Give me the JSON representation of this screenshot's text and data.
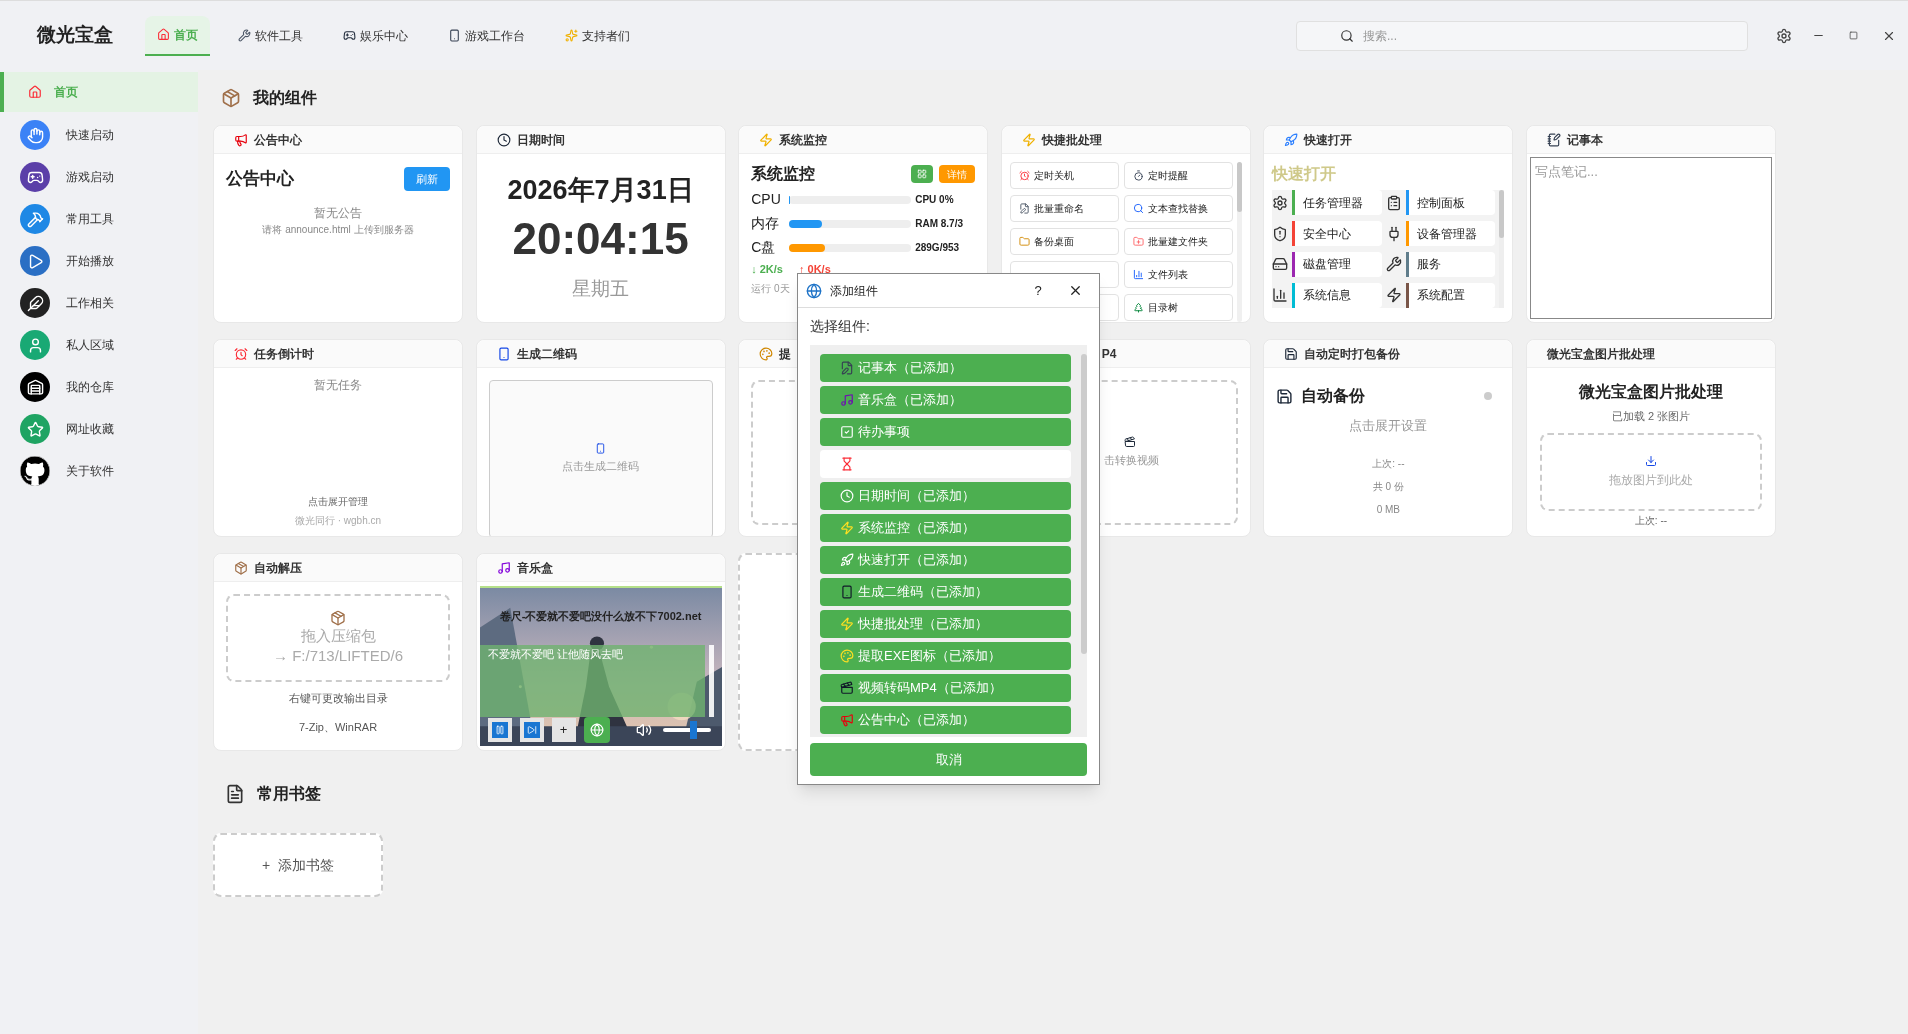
{
  "app": {
    "title": "微光宝盒"
  },
  "nav_tabs": [
    {
      "label": "首页",
      "selected": true
    },
    {
      "label": "软件工具",
      "selected": false
    },
    {
      "label": "娱乐中心",
      "selected": false
    },
    {
      "label": "游戏工作台",
      "selected": false
    },
    {
      "label": "支持者们",
      "selected": false
    }
  ],
  "search": {
    "placeholder": "搜索..."
  },
  "sidebar": {
    "items": [
      {
        "label": "首页",
        "selected": true
      },
      {
        "label": "快速启动",
        "selected": false
      },
      {
        "label": "游戏启动",
        "selected": false
      },
      {
        "label": "常用工具",
        "selected": false
      },
      {
        "label": "开始播放",
        "selected": false
      },
      {
        "label": "工作相关",
        "selected": false
      },
      {
        "label": "私人区域",
        "selected": false
      },
      {
        "label": "我的仓库",
        "selected": false
      },
      {
        "label": "网址收藏",
        "selected": false
      },
      {
        "label": "关于软件",
        "selected": false
      }
    ]
  },
  "section_title": "我的组件",
  "widgets": [
    {
      "kind": "announce",
      "header": "公告中心",
      "title": "公告中心",
      "button": "刷新",
      "empty": "暂无公告",
      "hint": "请将 announce.html 上传到服务器"
    },
    {
      "kind": "clock",
      "header": "日期时间",
      "date": "2026年7月31日",
      "time": "20:04:15",
      "weekday": "星期五"
    },
    {
      "kind": "monitor",
      "header": "系统监控",
      "title": "系统监控",
      "details_button": "详情",
      "meters": [
        {
          "label": "CPU",
          "level": 0,
          "reading": "CPU 0%"
        },
        {
          "label": "内存",
          "level": 0.27,
          "reading": "RAM 8.7/3",
          "color": "#2196f3"
        },
        {
          "label": "C盘",
          "level": 0.29,
          "reading": "289G/953",
          "color": "#ff9800"
        }
      ],
      "down": "↓ 2K/s",
      "up": "↑ 0K/s",
      "uptime": "运行 0天"
    },
    {
      "kind": "batch",
      "header": "快捷批处理",
      "rows": [
        [
          "定时关机",
          "定时提醒"
        ],
        [
          "批量重命名",
          "文本查找替换"
        ],
        [
          "备份桌面",
          "批量建文件夹"
        ],
        [
          null,
          "文件列表"
        ],
        [
          null,
          "目录树"
        ]
      ]
    },
    {
      "kind": "launcher",
      "header": "快速打开",
      "title": "快速打开",
      "items": [
        {
          "label": "任务管理器",
          "color": "#4caf50"
        },
        {
          "label": "控制面板",
          "color": "#2196f3"
        },
        {
          "label": "安全中心",
          "color": "#f44336"
        },
        {
          "label": "设备管理器",
          "color": "#ff9800"
        },
        {
          "label": "磁盘管理",
          "color": "#9c27b0"
        },
        {
          "label": "服务",
          "color": "#607d8b"
        },
        {
          "label": "系统信息",
          "color": "#00bcd4"
        },
        {
          "label": "系统配置",
          "color": "#795548"
        }
      ]
    },
    {
      "kind": "notepad",
      "header": "记事本",
      "placeholder": "写点笔记..."
    },
    {
      "kind": "countdown",
      "header": "任务倒计时",
      "empty": "暂无任务",
      "footer": "点击展开管理",
      "credit": "微光同行 · wgbh.cn"
    },
    {
      "kind": "qr",
      "header": "生成二维码",
      "action": "点击生成二维码"
    },
    {
      "kind": "extract",
      "header": "提"
    },
    {
      "kind": "video",
      "header": "P4",
      "action": "击转换视频"
    },
    {
      "kind": "backup",
      "header": "自动定时打包备份",
      "title": "自动备份",
      "on": false,
      "action": "点击展开设置",
      "last": "上次: --",
      "count": "共 0 份",
      "size": "0 MB"
    },
    {
      "kind": "images",
      "header": "微光宝盒图片批处理",
      "title": "微光宝盒图片批处理",
      "loaded": "已加载 2 张图片",
      "drop": "拖放图片到此处",
      "last": "上次: --"
    },
    {
      "kind": "unzip",
      "header": "自动解压",
      "drop": "拖入压缩包",
      "target": "→ F:/713/LIFTED/6",
      "hint": "右键可更改输出目录",
      "formats": "7-Zip、WinRAR"
    },
    {
      "kind": "music",
      "header": "音乐盒",
      "song": "卷尺-不爱就不爱吧没什么放不下7002.net",
      "lyric": "不爱就不爱吧 让他随风去吧",
      "playing": true,
      "add": "+",
      "volume": {
        "level": 0.63
      }
    },
    {
      "kind": "blank"
    }
  ],
  "bookmarks": {
    "title": "常用书签",
    "add": "+  添加书签"
  },
  "dialog": {
    "title": "添加组件",
    "help": "?",
    "prompt": "选择组件:",
    "options": [
      {
        "label": "记事本（已添加）",
        "selected": false
      },
      {
        "label": "音乐盒（已添加）",
        "selected": false
      },
      {
        "label": "待办事项",
        "selected": false
      },
      {
        "selected": true
      },
      {
        "label": "日期时间（已添加）",
        "selected": false
      },
      {
        "label": "系统监控（已添加）",
        "selected": false
      },
      {
        "label": "快速打开（已添加）",
        "selected": false
      },
      {
        "label": "生成二维码（已添加）",
        "selected": false
      },
      {
        "label": "快捷批处理（已添加）",
        "selected": false
      },
      {
        "label": "提取EXE图标（已添加）",
        "selected": false
      },
      {
        "label": "视频转码MP4（已添加）",
        "selected": false
      },
      {
        "label": "公告中心（已添加）",
        "selected": false
      }
    ],
    "cancel": "取消"
  }
}
